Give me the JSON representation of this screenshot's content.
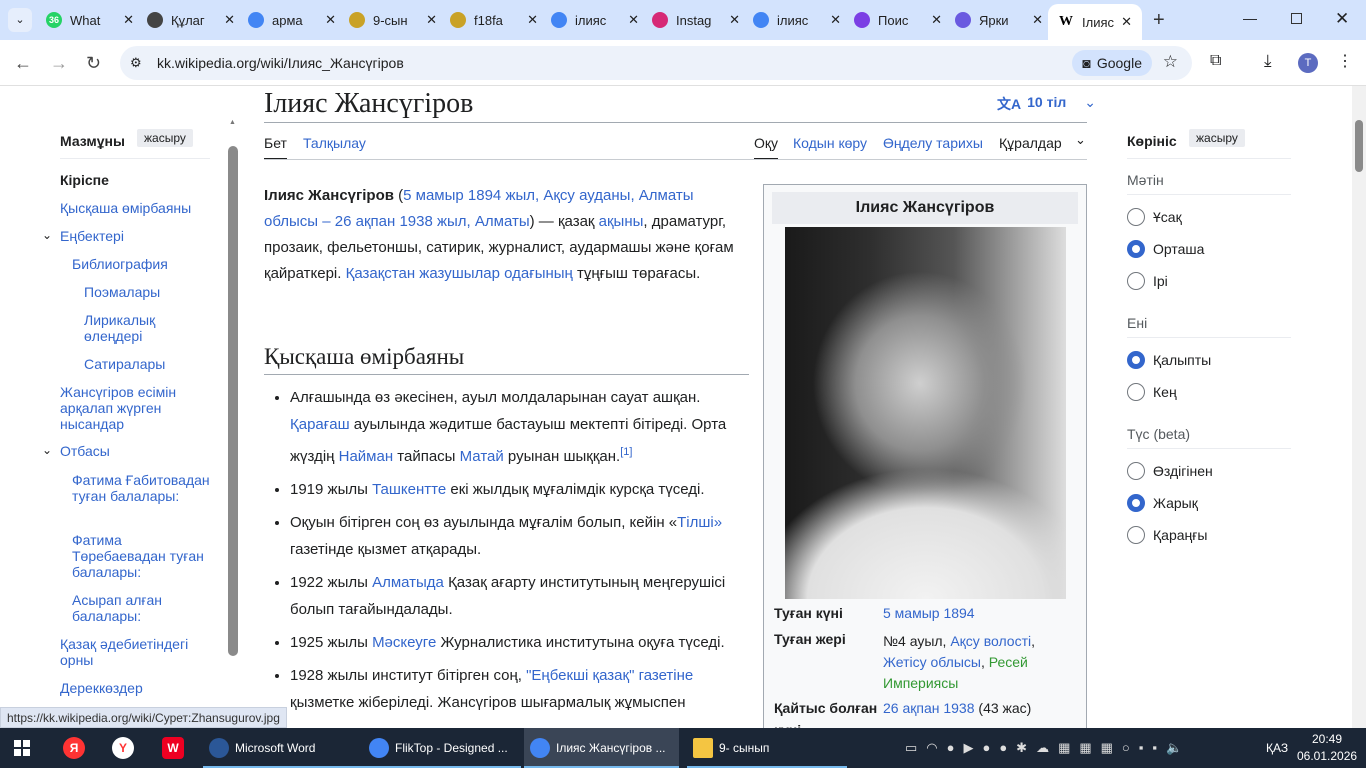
{
  "browser": {
    "tabs": [
      {
        "label": "What",
        "badge": "36",
        "color": "#25d366"
      },
      {
        "label": "Құлаг",
        "color": "#444"
      },
      {
        "label": "арма",
        "color": "#4285f4"
      },
      {
        "label": "9-сын",
        "color": "#c9a227"
      },
      {
        "label": "f18fa",
        "color": "#c9a227"
      },
      {
        "label": "ілияс",
        "color": "#4285f4"
      },
      {
        "label": "Instag",
        "color": "#d62976"
      },
      {
        "label": "ілияс",
        "color": "#4285f4"
      },
      {
        "label": "Поис",
        "color": "#7b3fe4"
      },
      {
        "label": "Ярки",
        "color": "#6a5ae0"
      },
      {
        "label": "Ілияс",
        "icon": "W"
      }
    ],
    "url": "kk.wikipedia.org/wiki/Ілияс_Жансүгіров",
    "lens_label": "Google",
    "profile_initial": "T",
    "status_url": "https://kk.wikipedia.org/wiki/Сурет:Zhansugurov.jpg"
  },
  "toc": {
    "title": "Мазмұны",
    "hide": "жасыру",
    "items": [
      "Кіріспе",
      "Қысқаша өмірбаяны",
      "Еңбектері",
      "Библиография",
      "Поэмалары",
      "Лирикалық өлеңдері",
      "Сатиралары",
      "Жансүгіров есімін арқалап жүрген нысандар",
      "Отбасы",
      "Фатима Ғабитовадан туған балалары:",
      "Фатима Төребаевадан туған балалары:",
      "Асырап алған балалары:",
      "Қазақ әдебиетіндегі орны",
      "Дереккөздер"
    ]
  },
  "article": {
    "title": "Ілияс Жансүгіров",
    "languages": "10 тіл",
    "tabs": {
      "page": "Бет",
      "talk": "Талқылау",
      "read": "Оқу",
      "source": "Кодын көру",
      "history": "Өңделу тарихы",
      "tools": "Құралдар"
    },
    "intro": {
      "bold": "Ілияс Жансүгіров",
      "t1": " (",
      "l1": "5 мамыр 1894 жыл",
      "c1": ", ",
      "l2": "Ақсу ауданы",
      "c2": ", ",
      "l3": "Алматы облысы",
      "t2": " – ",
      "l4": "26 ақпан 1938 жыл",
      "c3": ", ",
      "l5": "Алматы",
      "t3": ") — қазақ ",
      "l6": "ақыны",
      "t4": ", драматург, прозаик, фельетоншы, сатирик, журналист, аудармашы және қоғам қайраткері. ",
      "l7": "Қазақстан жазушылар одағының",
      "t5": " тұңғыш төрағасы."
    },
    "section": "Қысқаша өмірбаяны",
    "bullets": {
      "b1": {
        "t1": "Алғашында өз әкесінен, ауыл молдаларынан сауат ашқан. ",
        "l1": "Қарағаш",
        "t2": " ауылында жәдитше бастауыш мектепті бітіреді. Орта жүздің ",
        "l2": "Найман",
        "t3": " тайпасы ",
        "l3": "Матай",
        "t4": " руынан шыққан.",
        "ref": "[1]"
      },
      "b2": {
        "t1": "1919 жылы ",
        "l1": "Ташкентте",
        "t2": " екі жылдық мұғалімдік курсқа түседі."
      },
      "b3": {
        "t1": "Оқуын бітірген соң өз ауылында мұғалім болып, кейін «",
        "l1": "Тілші»",
        "t2": " газетінде қызмет атқарады."
      },
      "b4": {
        "t1": "1922 жылы ",
        "l1": "Алматыда",
        "t2": " Қазақ ағарту институтының меңгерушісі болып тағайындалады."
      },
      "b5": {
        "t1": "1925 жылы ",
        "l1": "Мәскеуге",
        "t2": " Журналистика институтына оқуға түседі."
      },
      "b6": {
        "t1": "1928 жылы институт бітірген соң, ",
        "l1": "\"Еңбекші қазақ\" газетіне",
        "t2": " қызметке жіберіледі. Жансүгіров шығармалық жұмыспен"
      }
    }
  },
  "infobox": {
    "title": "Ілияс Жансүгіров",
    "born_label": "Туған күні",
    "born": "5 мамыр 1894",
    "place_label": "Туған жері",
    "place_t": "№4 ауыл, ",
    "place_l1": "Ақсу волості",
    "place_c": ", ",
    "place_l2": "Жетісу облысы",
    "place_c2": ", ",
    "place_l3": "Ресей Империясы",
    "died_label": "Қайтыс болған күні",
    "died": "26 ақпан 1938",
    "died_age": " (43 жас)"
  },
  "appearance": {
    "title": "Көрініс",
    "hide": "жасыру",
    "text_label": "Мәтін",
    "text_options": [
      "Ұсақ",
      "Орташа",
      "Ірі"
    ],
    "text_selected": 1,
    "width_label": "Ені",
    "width_options": [
      "Қалыпты",
      "Кең"
    ],
    "width_selected": 0,
    "color_label": "Түс (beta)",
    "color_options": [
      "Өздігінен",
      "Жарық",
      "Қараңғы"
    ],
    "color_selected": 1
  },
  "taskbar": {
    "apps": [
      "Microsoft Word",
      "FlikTop - Designed ...",
      "Ілияс Жансүгіров ...",
      "9- сынып"
    ],
    "lang": "ҚАЗ",
    "time": "20:49",
    "date": "06.01.2026"
  }
}
